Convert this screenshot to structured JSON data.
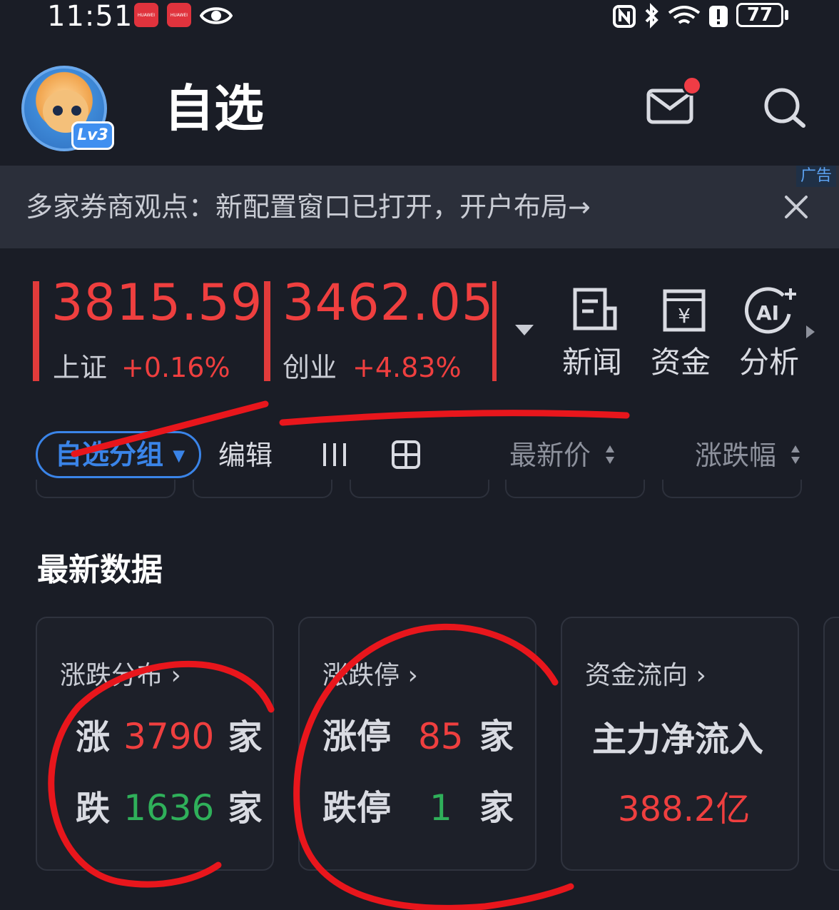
{
  "status_bar": {
    "time": "11:51",
    "notification_brand": "HUAWEI",
    "battery": "77"
  },
  "header": {
    "title": "自选",
    "level_badge": "Lv3",
    "has_unread_mail": true
  },
  "ad_banner": {
    "text": "多家券商观点：新配置窗口已打开，开户布局→",
    "tag": "广告"
  },
  "indices": [
    {
      "value": "3815.59",
      "name": "上证",
      "change": "+0.16%"
    },
    {
      "value": "3462.05",
      "name": "创业",
      "change": "+4.83%"
    }
  ],
  "tools": [
    {
      "label": "新闻",
      "icon": "news-icon"
    },
    {
      "label": "资金",
      "icon": "funds-icon"
    },
    {
      "label": "分析",
      "icon": "ai-analysis-icon"
    }
  ],
  "list_toolbar": {
    "group_button": "自选分组",
    "edit_button": "编辑",
    "sort_latest_price": "最新价",
    "sort_change_pct": "涨跌幅"
  },
  "latest_data": {
    "title": "最新数据",
    "cards": [
      {
        "title": "涨跌分布",
        "rows": [
          {
            "label": "涨",
            "value": "3790",
            "unit": "家"
          },
          {
            "label": "跌",
            "value": "1636",
            "unit": "家"
          }
        ]
      },
      {
        "title": "涨跌停",
        "rows": [
          {
            "label": "涨停",
            "value": "85",
            "unit": "家"
          },
          {
            "label": "跌停",
            "value": "1",
            "unit": "家"
          }
        ]
      },
      {
        "title": "资金流向",
        "headline": "主力净流入",
        "value": "388.2亿"
      }
    ]
  },
  "colors": {
    "background": "#1a1d26",
    "up_red": "#ef3f3f",
    "down_green": "#2fb05a",
    "accent_blue": "#3a84e8",
    "annotation_red": "#e8161c"
  }
}
